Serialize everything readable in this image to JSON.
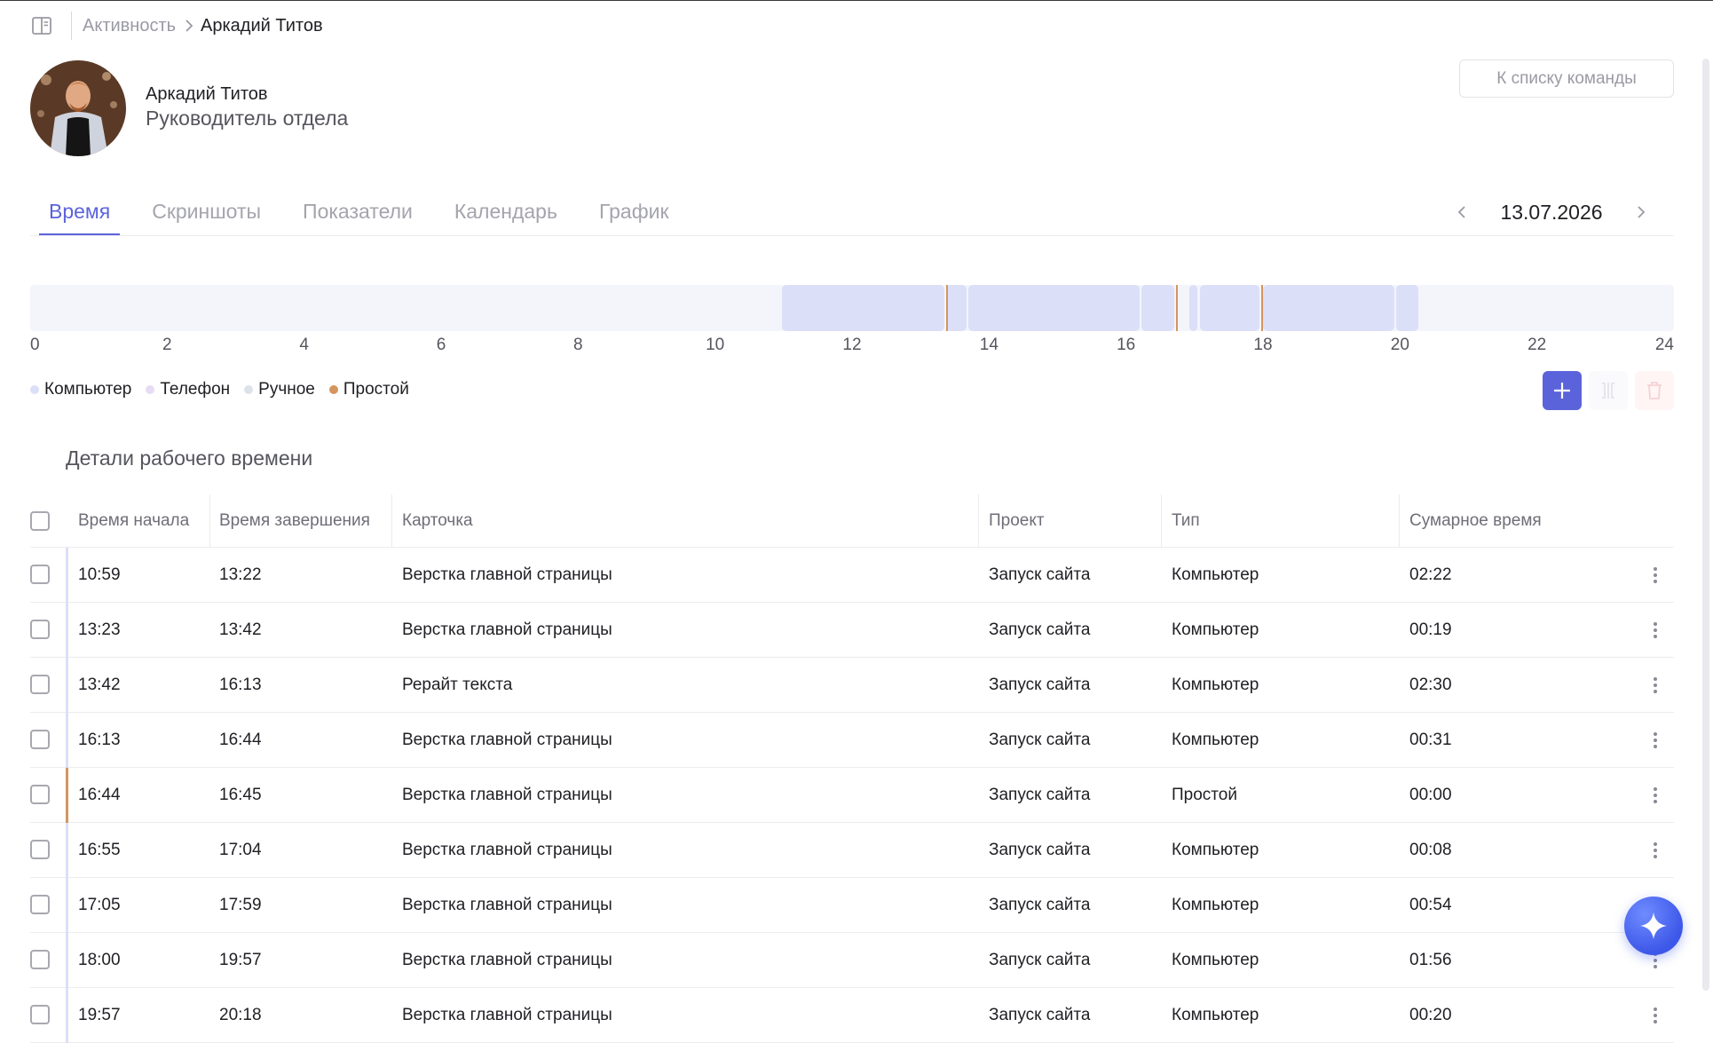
{
  "breadcrumb": {
    "parent": "Активность",
    "current": "Аркадий Титов"
  },
  "profile": {
    "name": "Аркадий Титов",
    "role": "Руководитель отдела",
    "team_button": "К списку команды"
  },
  "tabs": [
    "Время",
    "Скриншоты",
    "Показатели",
    "Календарь",
    "График"
  ],
  "active_tab": "Время",
  "date": "13.07.2026",
  "timeline": {
    "ticks": [
      "0",
      "2",
      "4",
      "6",
      "8",
      "10",
      "12",
      "14",
      "16",
      "18",
      "20",
      "22",
      "24"
    ],
    "segments": [
      {
        "start_h": 10.98,
        "end_h": 13.37,
        "type": "computer"
      },
      {
        "start_h": 13.38,
        "end_h": 13.7,
        "type": "computer"
      },
      {
        "start_h": 13.7,
        "end_h": 16.22,
        "type": "computer"
      },
      {
        "start_h": 16.22,
        "end_h": 16.73,
        "type": "computer"
      },
      {
        "start_h": 16.92,
        "end_h": 17.07,
        "type": "computer"
      },
      {
        "start_h": 17.08,
        "end_h": 17.98,
        "type": "computer"
      },
      {
        "start_h": 18.0,
        "end_h": 19.95,
        "type": "computer"
      },
      {
        "start_h": 19.95,
        "end_h": 20.3,
        "type": "computer"
      }
    ],
    "idle_markers_h": [
      13.37,
      16.73,
      17.98
    ],
    "colors": {
      "computer": "#dcdff8",
      "phone": "#e6dcf4",
      "manual": "#dde3ea",
      "idle": "#d4955f",
      "track": "#f4f5fb"
    }
  },
  "legend": [
    {
      "label": "Компьютер",
      "color": "#dcdff8"
    },
    {
      "label": "Телефон",
      "color": "#e6dcf4"
    },
    {
      "label": "Ручное",
      "color": "#dde3ea"
    },
    {
      "label": "Простой",
      "color": "#d4955f"
    }
  ],
  "details_title": "Детали рабочего времени",
  "table": {
    "headers": [
      "Время начала",
      "Время завершения",
      "Карточка",
      "Проект",
      "Тип",
      "Сумарное время"
    ],
    "rows": [
      [
        "10:59",
        "13:22",
        "Верстка главной страницы",
        "Запуск сайта",
        "Компьютер",
        "02:22"
      ],
      [
        "13:23",
        "13:42",
        "Верстка главной страницы",
        "Запуск сайта",
        "Компьютер",
        "00:19"
      ],
      [
        "13:42",
        "16:13",
        "Рерайт текста",
        "Запуск сайта",
        "Компьютер",
        "02:30"
      ],
      [
        "16:13",
        "16:44",
        "Верстка главной страницы",
        "Запуск сайта",
        "Компьютер",
        "00:31"
      ],
      [
        "16:44",
        "16:45",
        "Верстка главной страницы",
        "Запуск сайта",
        "Простой",
        "00:00"
      ],
      [
        "16:55",
        "17:04",
        "Верстка главной страницы",
        "Запуск сайта",
        "Компьютер",
        "00:08"
      ],
      [
        "17:05",
        "17:59",
        "Верстка главной страницы",
        "Запуск сайта",
        "Компьютер",
        "00:54"
      ],
      [
        "18:00",
        "19:57",
        "Верстка главной страницы",
        "Запуск сайта",
        "Компьютер",
        "01:56"
      ],
      [
        "19:57",
        "20:18",
        "Верстка главной страницы",
        "Запуск сайта",
        "Компьютер",
        "00:20"
      ]
    ]
  },
  "colors": {
    "accent": "#5b63db",
    "idle": "#d4955f",
    "fab": "#3d57e8"
  },
  "icons": {
    "sidebar": "sidebar-toggle-icon",
    "add": "plus-icon",
    "split": "split-icon",
    "delete": "trash-icon",
    "more": "kebab-icon",
    "assistant": "sparkle-icon"
  }
}
